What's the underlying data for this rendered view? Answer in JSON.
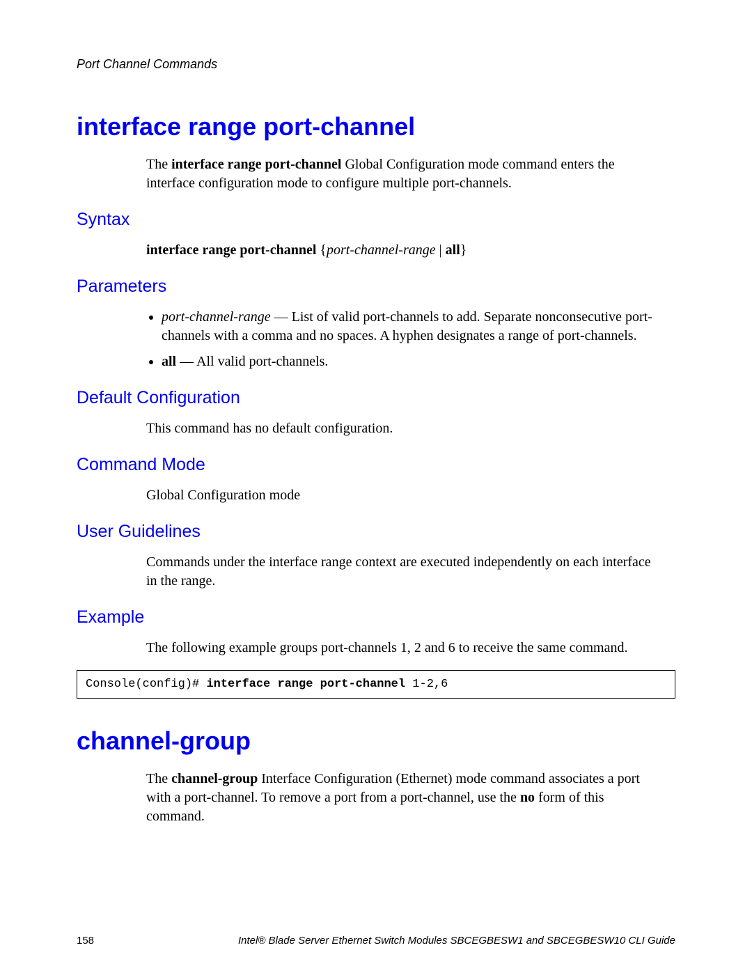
{
  "chapter": "Port Channel Commands",
  "cmd1": {
    "title": "interface range port-channel",
    "intro_pre": "The ",
    "intro_bold": "interface range port-channel",
    "intro_post": " Global Configuration mode command enters the interface configuration mode to configure multiple port-channels.",
    "syntax_heading": "Syntax",
    "syntax_bold": "interface range port-channel",
    "syntax_brace_open": " {",
    "syntax_italic": "port-channel-range",
    "syntax_sep": " | ",
    "syntax_all": "all",
    "syntax_brace_close": "}",
    "parameters_heading": "Parameters",
    "param1_italic": "port-channel-range",
    "param1_rest": " — List of valid port-channels to add. Separate nonconsecutive port-channels with a comma and no spaces. A hyphen designates a range of port-channels.",
    "param2_bold": "all",
    "param2_rest": " — All valid port-channels.",
    "defcfg_heading": "Default Configuration",
    "defcfg_text": "This command has no default configuration.",
    "mode_heading": "Command Mode",
    "mode_text": "Global Configuration mode",
    "guidelines_heading": "User Guidelines",
    "guidelines_text": "Commands under the interface range context are executed independently on each interface in the range.",
    "example_heading": "Example",
    "example_text": "The following example groups port-channels 1, 2 and 6 to receive the same command.",
    "console_prompt": "Console(config)# ",
    "console_bold": "interface range port-channel",
    "console_args": " 1-2,6"
  },
  "cmd2": {
    "title": "channel-group",
    "intro_pre": "The ",
    "intro_bold1": "channel-group",
    "intro_mid": " Interface Configuration (Ethernet) mode command associates a port with a port-channel. To remove a port from a port-channel, use the ",
    "intro_bold2": "no",
    "intro_post": " form of this command."
  },
  "footer": {
    "page": "158",
    "title": "Intel® Blade Server Ethernet Switch Modules SBCEGBESW1 and SBCEGBESW10 CLI Guide"
  }
}
